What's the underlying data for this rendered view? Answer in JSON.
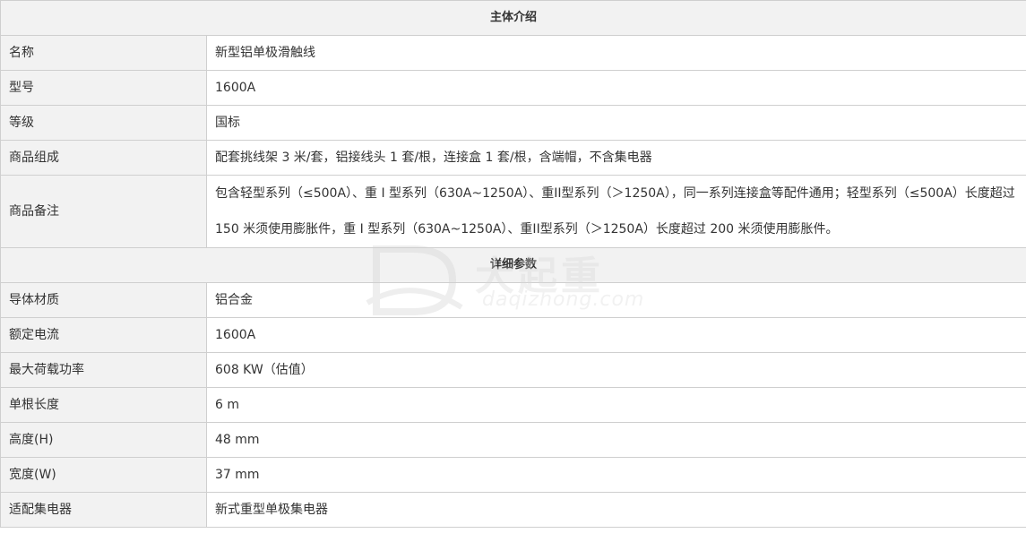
{
  "sections": {
    "intro_title": "主体介绍",
    "detail_title": "详细参数"
  },
  "intro_rows": [
    {
      "label": "名称",
      "value": "新型铝单极滑触线"
    },
    {
      "label": "型号",
      "value": "1600A"
    },
    {
      "label": "等级",
      "value": "国标"
    },
    {
      "label": "商品组成",
      "value": "配套挑线架 3 米/套，铝接线头 1 套/根，连接盒 1 套/根，含端帽，不含集电器"
    },
    {
      "label": "商品备注",
      "value": "包含轻型系列（≤500A）、重 I 型系列（630A~1250A）、重II型系列（＞1250A），同一系列连接盒等配件通用；轻型系列（≤500A）长度超过 150 米须使用膨胀件，重 I 型系列（630A~1250A）、重II型系列（＞1250A）长度超过 200 米须使用膨胀件。"
    }
  ],
  "detail_rows": [
    {
      "label": "导体材质",
      "value": "铝合金"
    },
    {
      "label": "额定电流",
      "value": "1600A"
    },
    {
      "label": "最大荷载功率",
      "value": "608 KW（估值）"
    },
    {
      "label": "单根长度",
      "value": "6 m"
    },
    {
      "label": "高度(H)",
      "value": "48 mm"
    },
    {
      "label": "宽度(W)",
      "value": "37 mm"
    },
    {
      "label": "适配集电器",
      "value": "新式重型单极集电器"
    }
  ],
  "watermark": {
    "cn": "大起重",
    "en": "daqizhong.com"
  }
}
